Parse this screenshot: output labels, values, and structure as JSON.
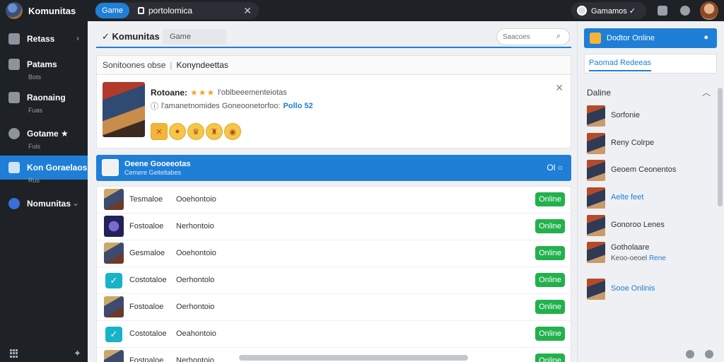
{
  "app": {
    "title": "Komunitas"
  },
  "tab": {
    "active_label": "Game",
    "title": "portolomica",
    "close_glyph": "✕"
  },
  "user": {
    "name": "Gamamos ✓"
  },
  "sidebar": {
    "items": [
      {
        "label": "Retass",
        "sub": "",
        "icon": "store-icon"
      },
      {
        "label": "Patams",
        "sub": "Bots",
        "icon": "tools-icon"
      },
      {
        "label": "Raonaing",
        "sub": "Fuas",
        "icon": "chart-icon"
      },
      {
        "label": "Gotame ★",
        "sub": "Fuis",
        "icon": "game-icon"
      },
      {
        "label": "Kon Goraelaos",
        "sub": "Rus",
        "icon": "friends-icon"
      },
      {
        "label": "Nomunitas",
        "sub": "",
        "icon": "community-icon"
      }
    ]
  },
  "main": {
    "title": "Komunitas",
    "chip": "Game",
    "search_placeholder": "Saacoes",
    "filter": {
      "label": "Sonitoones obse",
      "value": "Konyndeettas"
    },
    "card": {
      "name": "Rotoane:",
      "stars": "★★★",
      "desc": "l'oblbeeementeiotas",
      "line2": "l'amanetnomides Goneoonetorfoo:",
      "highlight": "Pollo 52"
    },
    "selected": {
      "title": "Oeene Gooeeotas",
      "subtitle": "Cemere Geiteltabes",
      "actions": "Ol ○"
    },
    "rows": [
      {
        "name": "Tesmaloe",
        "detail": "Ooehontoio",
        "status": "Online",
        "avatar": "game-avatar"
      },
      {
        "name": "Fostoaloe",
        "detail": "Nerhontoio",
        "status": "Online",
        "avatar": "dark-avatar"
      },
      {
        "name": "Gesmaloe",
        "detail": "Ooehontoio",
        "status": "Online",
        "avatar": "game-avatar"
      },
      {
        "name": "Costotaloe",
        "detail": "Oerhontolo",
        "status": "Online",
        "avatar": "check-avatar"
      },
      {
        "name": "Fostoaloe",
        "detail": "Oerhontoio",
        "status": "Online",
        "avatar": "game-avatar"
      },
      {
        "name": "Costotaloe",
        "detail": "Oeahontoio",
        "status": "Online",
        "avatar": "check-avatar"
      },
      {
        "name": "Fostoaloe",
        "detail": "Nerhontoio",
        "status": "Online",
        "avatar": "game-avatar"
      }
    ]
  },
  "right": {
    "button": "Dodtor Online",
    "tab": "Paomad Redeeas",
    "section": "Daline",
    "items": [
      {
        "name": "Sorfonie",
        "sub": "",
        "blue": false
      },
      {
        "name": "Reny Colrpe",
        "sub": "",
        "blue": false
      },
      {
        "name": "Geoem Ceonentos",
        "sub": "",
        "blue": false
      },
      {
        "name": "Aelte feet",
        "sub": "",
        "blue": true
      },
      {
        "name": "Gonoroo Lenes",
        "sub": "",
        "blue": false
      },
      {
        "name": "Gotholaare",
        "sub": "Keoo-oeoel",
        "sub_hl": "Rene",
        "blue": false
      },
      {
        "name": "Sooe Onlinis",
        "sub": "",
        "blue": true
      }
    ]
  },
  "colors": {
    "accent": "#1f7fd6",
    "online": "#22b14c",
    "dark": "#1e2126"
  }
}
